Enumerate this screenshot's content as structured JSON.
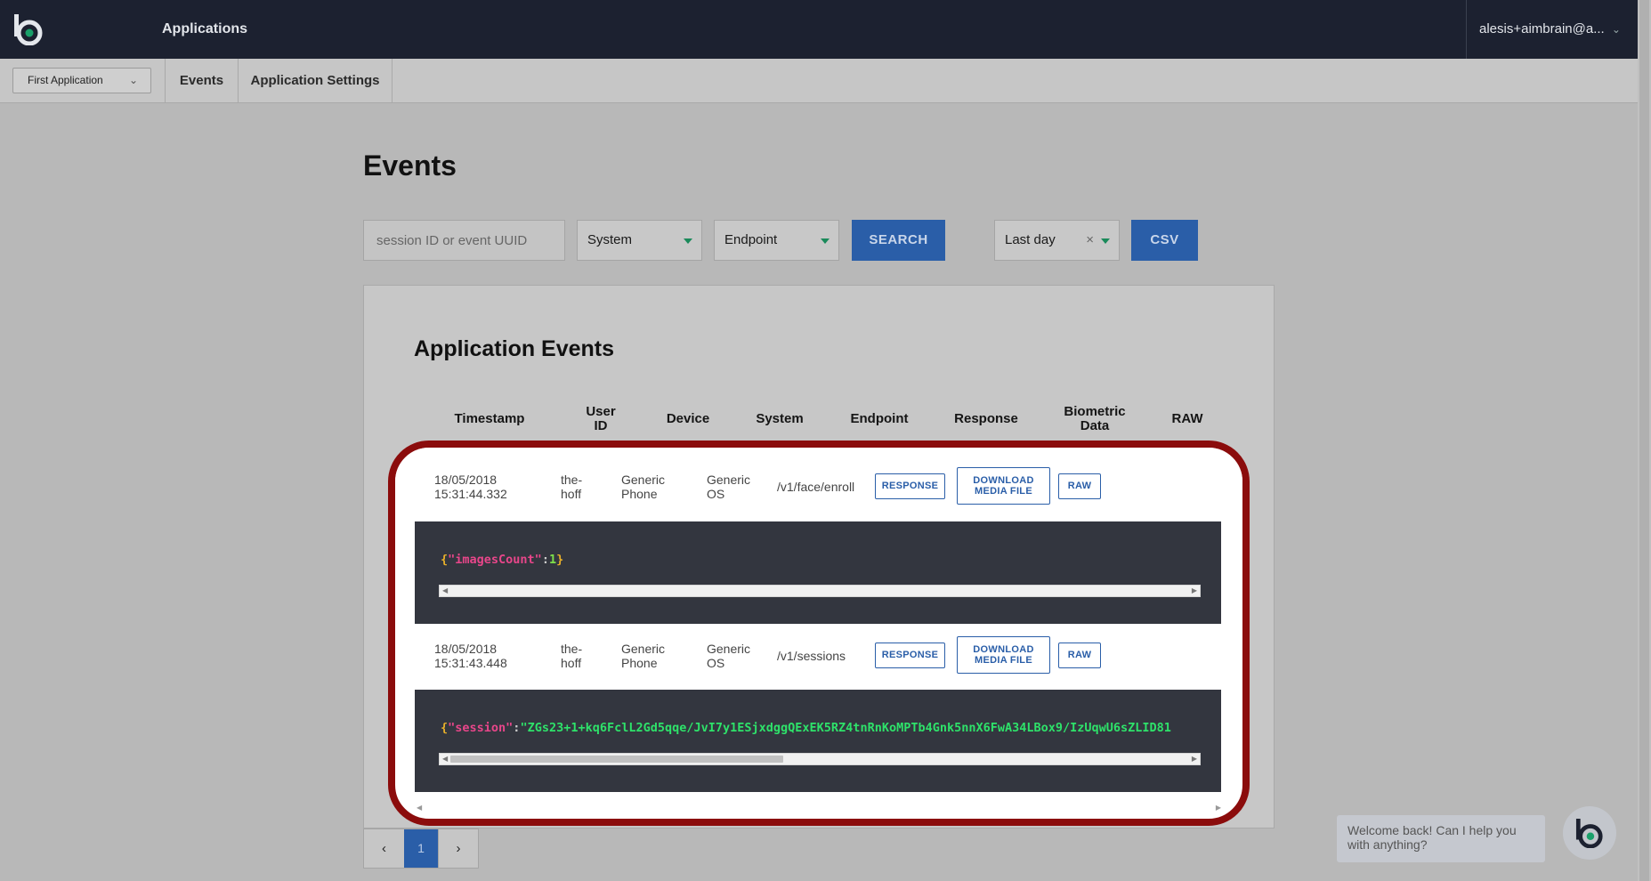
{
  "header": {
    "title": "Applications",
    "user": "alesis+aimbrain@a..."
  },
  "subnav": {
    "app_select": "First Application",
    "tabs": [
      {
        "label": "Events"
      },
      {
        "label": "Application Settings"
      }
    ]
  },
  "page": {
    "title": "Events"
  },
  "filters": {
    "search_placeholder": "session ID or event UUID",
    "system": "System",
    "endpoint": "Endpoint",
    "search_button": "SEARCH",
    "range": "Last day",
    "range_clear": "×",
    "csv_button": "CSV"
  },
  "table": {
    "title": "Application Events",
    "columns": [
      "Timestamp",
      "User ID",
      "Device",
      "System",
      "Endpoint",
      "Response",
      "Biometric Data",
      "RAW"
    ],
    "response_label": "RESPONSE",
    "download_label": "DOWNLOAD MEDIA FILE",
    "raw_label": "RAW",
    "rows": [
      {
        "date": "18/05/2018",
        "time": "15:31:44.332",
        "user_1": "the-",
        "user_2": "hoff",
        "device_1": "Generic",
        "device_2": "Phone",
        "system_1": "Generic",
        "system_2": "OS",
        "endpoint": "/v1/face/enroll",
        "payload_brace_open": "{",
        "payload_key": "\"imagesCount\"",
        "payload_colon": ":",
        "payload_value": "1",
        "payload_brace_close": "}"
      },
      {
        "date": "18/05/2018",
        "time": "15:31:43.448",
        "user_1": "the-",
        "user_2": "hoff",
        "device_1": "Generic",
        "device_2": "Phone",
        "system_1": "Generic",
        "system_2": "OS",
        "endpoint": "/v1/sessions",
        "payload_brace_open": "{",
        "payload_key": "\"session\"",
        "payload_colon": ":",
        "payload_value": "\"ZGs23+1+kq6FclL2Gd5qqe/JvI7y1ESjxdggQExEK5RZ4tnRnKoMPTb4Gnk5nnX6FwA34LBox9/IzUqwU6sZLID81",
        "scroll_fraction": 0.45
      }
    ]
  },
  "pagination": {
    "prev": "‹",
    "current": "1",
    "next": "›"
  },
  "chat": {
    "message": "Welcome back! Can I help you with anything?"
  }
}
